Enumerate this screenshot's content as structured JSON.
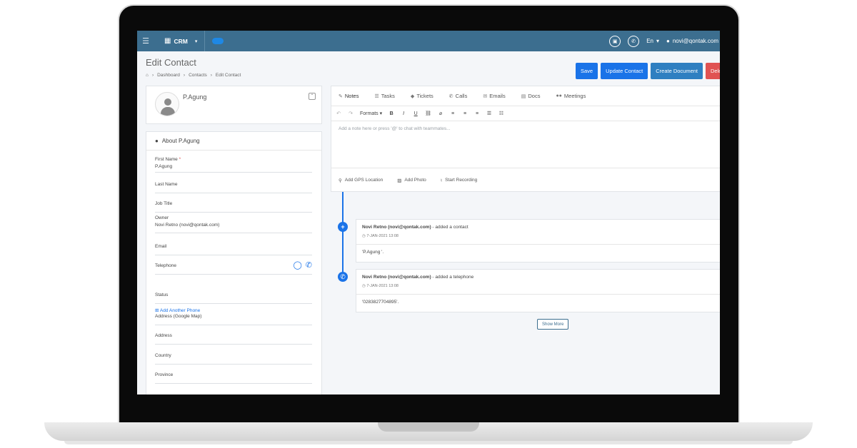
{
  "topbar": {
    "app_name": "CRM",
    "language": "En",
    "user_email": "novi@qontak.com"
  },
  "page": {
    "title": "Edit Contact",
    "breadcrumb": [
      "Dashboard",
      "Contacts",
      "Edit Contact"
    ]
  },
  "buttons": {
    "save": "Save",
    "update": "Update Contact",
    "create_document": "Create Document",
    "delete": "Dele"
  },
  "profile": {
    "name": "P.Agung"
  },
  "about": {
    "heading": "About P.Agung",
    "fields": [
      {
        "label": "First Name",
        "required": "*",
        "value": "P.Agung"
      },
      {
        "label": "Last Name",
        "value": ""
      },
      {
        "label": "Job Title",
        "value": ""
      },
      {
        "label": "Owner",
        "value": "Novi Retno (novi@qontak.com)"
      },
      {
        "label": "Email",
        "value": ""
      },
      {
        "label": "Telephone",
        "value": ""
      },
      {
        "label": "Status",
        "value": ""
      },
      {
        "label": "Address (Google Map)",
        "value": ""
      },
      {
        "label": "Address",
        "value": ""
      },
      {
        "label": "Country",
        "value": ""
      },
      {
        "label": "Province",
        "value": ""
      }
    ],
    "add_phone": "Add Another Phone"
  },
  "tabs": [
    "Notes",
    "Tasks",
    "Tickets",
    "Calls",
    "Emails",
    "Docs",
    "Meetings"
  ],
  "toolbar": {
    "formats": "Formats"
  },
  "note": {
    "placeholder": "Add a note here or press '@' to chat with teammates...",
    "actions": [
      "Add GPS Location",
      "Add Photo",
      "Start Recording"
    ]
  },
  "timeline": [
    {
      "author": "Novi Retno (novi@qontak.com)",
      "action": " - added a contact",
      "time": "7-JAN-2021 13:08",
      "content": "'P.Agung '."
    },
    {
      "author": "Novi Retno (novi@qontak.com)",
      "action": " - added a telephone",
      "time": "7-JAN-2021 13:08",
      "content": "'0283827704895'."
    }
  ],
  "show_more": "Show More",
  "colors": {
    "topbar": "#3c6e8f",
    "primary": "#1a73e8",
    "danger": "#e05252"
  }
}
